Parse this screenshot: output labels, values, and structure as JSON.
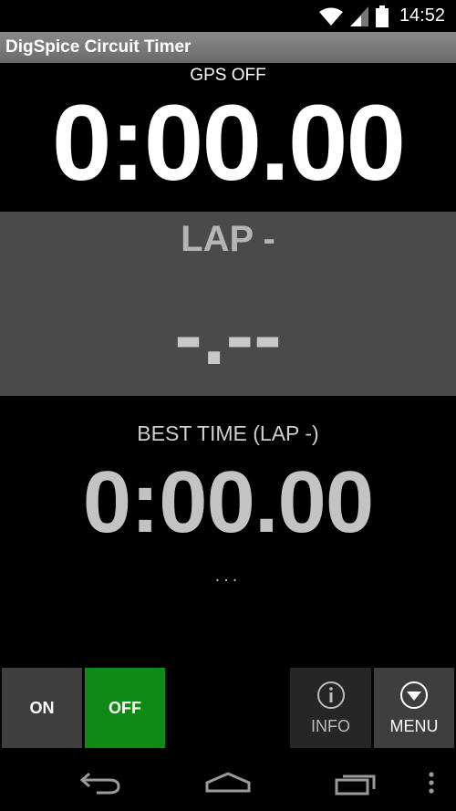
{
  "status_bar": {
    "time": "14:52",
    "icons": [
      "wifi-icon",
      "signal-icon",
      "battery-icon"
    ]
  },
  "app": {
    "title": "DigSpice Circuit Timer"
  },
  "gps": {
    "status": "GPS OFF"
  },
  "timer": {
    "current": "0:00.00"
  },
  "lap": {
    "label": "LAP -",
    "time": "-.--"
  },
  "best": {
    "label": "BEST TIME (LAP -)",
    "time": "0:00.00",
    "ellipsis": "..."
  },
  "buttons": {
    "on": "ON",
    "off": "OFF",
    "info": "INFO",
    "menu": "MENU"
  },
  "nav": {
    "icons": [
      "back-icon",
      "home-icon",
      "recent-apps-icon",
      "overflow-menu-icon"
    ]
  },
  "colors": {
    "off_active": "#0f8a14",
    "lap_panel": "#4a4a4a",
    "button_gray": "#3e3e3e"
  }
}
